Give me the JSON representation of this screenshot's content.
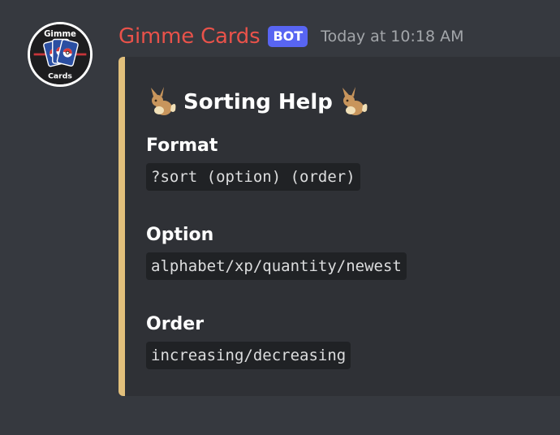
{
  "message": {
    "author": "Gimme Cards",
    "bot_tag": "BOT",
    "timestamp": "Today at 10:18 AM",
    "avatar": {
      "icon": "gimme-cards-logo",
      "text_top": "Gimme",
      "text_bottom": "Cards"
    }
  },
  "embed": {
    "accent_color": "#e2c07c",
    "title_icon": "eevee-icon",
    "title": "Sorting Help",
    "fields": [
      {
        "name": "Format",
        "value": "?sort (option) (order)"
      },
      {
        "name": "Option",
        "value": "alphabet/xp/quantity/newest"
      },
      {
        "name": "Order",
        "value": "increasing/decreasing"
      }
    ]
  },
  "colors": {
    "background": "#36393f",
    "embed_background": "#2f3136",
    "username": "#e9524a",
    "bot_tag": "#5865f2",
    "timestamp": "#a3a6aa",
    "code_background": "#202225"
  }
}
